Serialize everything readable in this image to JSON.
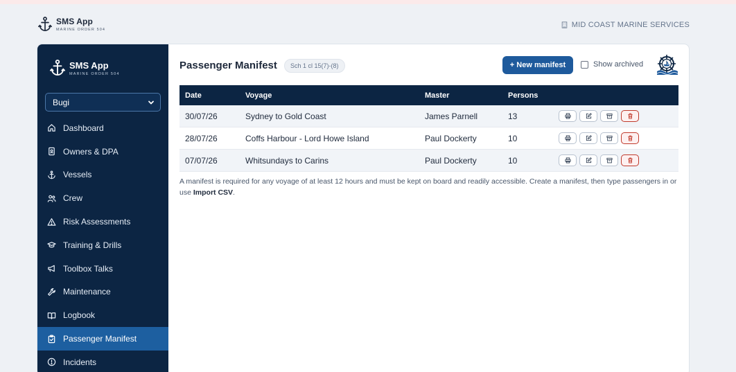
{
  "topbar": {
    "brand_title": "SMS App",
    "brand_subtitle": "MARINE ORDER 504",
    "org_name": "MID COAST MARINE SERVICES"
  },
  "sidebar": {
    "brand_title": "SMS App",
    "brand_subtitle": "MARINE ORDER 504",
    "vessel_selected": "Bugi",
    "items": [
      {
        "label": "Dashboard",
        "icon": "home-icon"
      },
      {
        "label": "Owners & DPA",
        "icon": "id-badge-icon"
      },
      {
        "label": "Vessels",
        "icon": "anchor-icon"
      },
      {
        "label": "Crew",
        "icon": "users-icon"
      },
      {
        "label": "Risk Assessments",
        "icon": "warning-icon"
      },
      {
        "label": "Training & Drills",
        "icon": "graduation-cap-icon"
      },
      {
        "label": "Toolbox Talks",
        "icon": "megaphone-icon"
      },
      {
        "label": "Maintenance",
        "icon": "wrench-icon"
      },
      {
        "label": "Logbook",
        "icon": "book-icon"
      },
      {
        "label": "Passenger Manifest",
        "icon": "clipboard-check-icon",
        "active": true
      },
      {
        "label": "Incidents",
        "icon": "alert-circle-icon"
      }
    ]
  },
  "main": {
    "title": "Passenger Manifest",
    "ref_badge": "Sch 1 cl 15(7)-(8)",
    "new_button": "+ New manifest",
    "show_archived_label": "Show archived",
    "show_archived_checked": false,
    "table": {
      "columns": [
        "Date",
        "Voyage",
        "Master",
        "Persons"
      ],
      "rows": [
        {
          "date": "30/07/26",
          "voyage": "Sydney to Gold Coast",
          "master": "James Parnell",
          "persons": "13"
        },
        {
          "date": "28/07/26",
          "voyage": "Coffs Harbour - Lord Howe Island",
          "master": "Paul Dockerty",
          "persons": "10"
        },
        {
          "date": "07/07/26",
          "voyage": "Whitsundays to Carins",
          "master": "Paul Dockerty",
          "persons": "10"
        }
      ],
      "row_actions": [
        "print-icon",
        "edit-icon",
        "archive-icon",
        "trash-icon"
      ]
    },
    "note_text": "A manifest is required for any voyage of at least 12 hours and must be kept on board and readily accessible. Create a manifest, then type passengers in or use ",
    "note_link": "Import CSV",
    "note_end": "."
  },
  "colors": {
    "sidebar_bg": "#0c2543",
    "active_item": "#1d5fa0",
    "primary_button": "#1e5a9c",
    "danger": "#c0392b"
  }
}
